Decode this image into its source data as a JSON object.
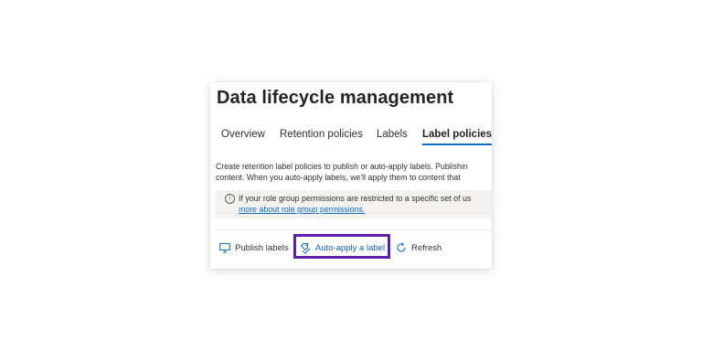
{
  "page": {
    "title": "Data lifecycle management"
  },
  "tabs": [
    {
      "label": "Overview",
      "active": false
    },
    {
      "label": "Retention policies",
      "active": false
    },
    {
      "label": "Labels",
      "active": false
    },
    {
      "label": "Label policies",
      "active": true
    }
  ],
  "description": {
    "line1": "Create retention label policies to publish or auto-apply labels. Publishin",
    "line2": "content. When you auto-apply labels, we'll apply them to content that"
  },
  "info_banner": {
    "icon": "info-icon",
    "text": "If your role group permissions are restricted to a specific set of us",
    "link": "more about role group permissions."
  },
  "command_bar": {
    "publish_labels": {
      "label": "Publish labels",
      "icon": "publish-icon"
    },
    "auto_apply": {
      "label": "Auto-apply a label",
      "icon": "auto-apply-icon",
      "highlighted": true
    },
    "refresh": {
      "label": "Refresh",
      "icon": "refresh-icon"
    }
  },
  "colors": {
    "accent": "#0f6cbd",
    "highlight_border": "#5b1fa8",
    "banner_bg": "#f3f2f1",
    "text": "#323130"
  }
}
